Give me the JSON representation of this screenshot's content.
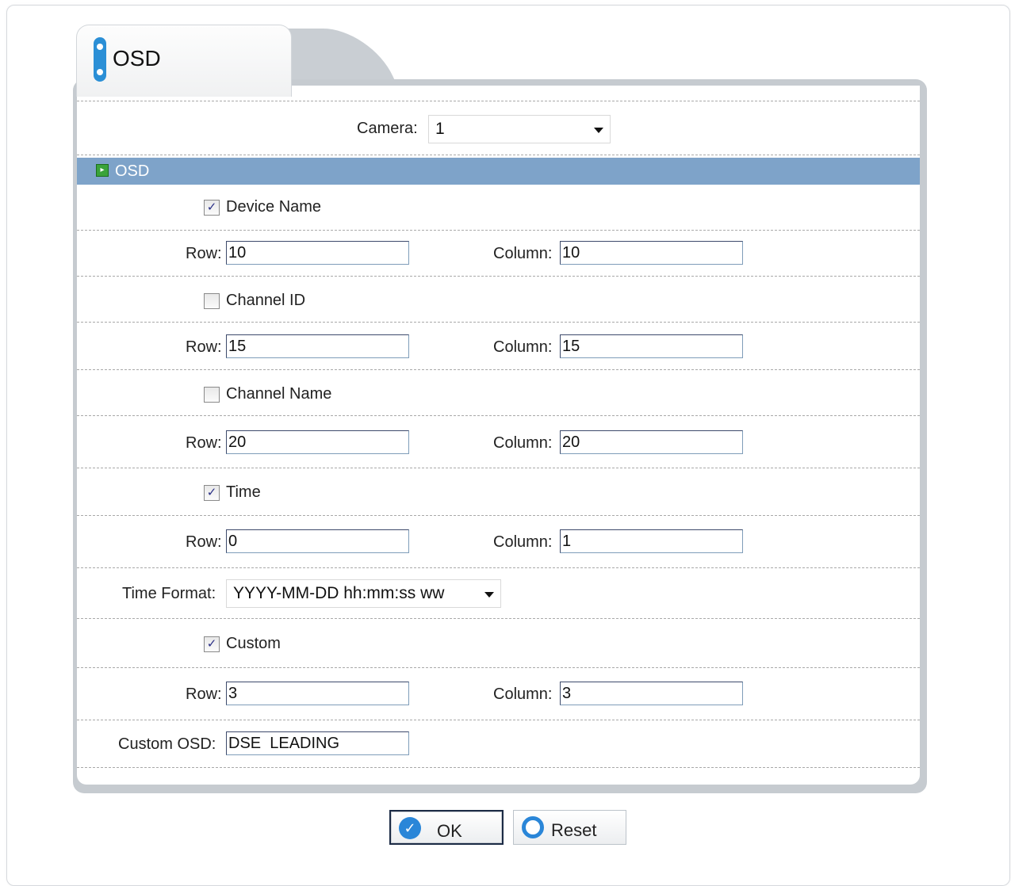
{
  "tab": {
    "title": "OSD"
  },
  "camera": {
    "label": "Camera:",
    "value": "1"
  },
  "section": {
    "title": "OSD"
  },
  "items": {
    "device_name": {
      "label": "Device Name",
      "checked": true,
      "row_label": "Row:",
      "row": "10",
      "col_label": "Column:",
      "col": "10"
    },
    "channel_id": {
      "label": "Channel ID",
      "checked": false,
      "row_label": "Row:",
      "row": "15",
      "col_label": "Column:",
      "col": "15"
    },
    "channel_name": {
      "label": "Channel Name",
      "checked": false,
      "row_label": "Row:",
      "row": "20",
      "col_label": "Column:",
      "col": "20"
    },
    "time": {
      "label": "Time",
      "checked": true,
      "row_label": "Row:",
      "row": "0",
      "col_label": "Column:",
      "col": "1"
    },
    "custom": {
      "label": "Custom",
      "checked": true,
      "row_label": "Row:",
      "row": "3",
      "col_label": "Column:",
      "col": "3"
    }
  },
  "time_format": {
    "label": "Time Format:",
    "value": "YYYY-MM-DD hh:mm:ss ww"
  },
  "custom_osd": {
    "label": "Custom OSD:",
    "value": "DSE  LEADING"
  },
  "buttons": {
    "ok": "OK",
    "reset": "Reset"
  },
  "checkmark": "✓",
  "colors": {
    "section_bar": "#7ea3c9",
    "accent": "#2a86d8",
    "panel": "#c6cbd0"
  }
}
